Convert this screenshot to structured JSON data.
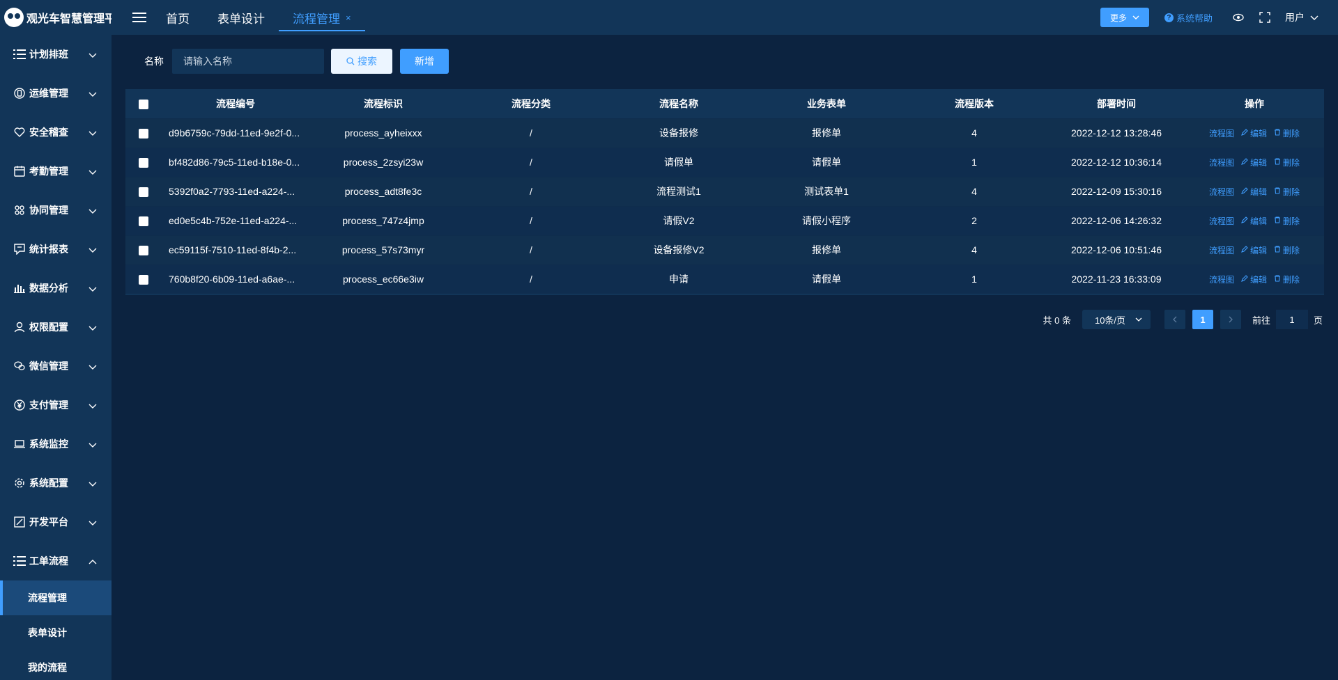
{
  "app": {
    "title": "观光车智慧管理平台"
  },
  "sidebar": {
    "items": [
      {
        "label": "计划排班",
        "icon": "list-icon"
      },
      {
        "label": "运维管理",
        "icon": "device-icon"
      },
      {
        "label": "安全稽查",
        "icon": "heart-icon"
      },
      {
        "label": "考勤管理",
        "icon": "calendar-icon"
      },
      {
        "label": "协同管理",
        "icon": "grid-icon"
      },
      {
        "label": "统计报表",
        "icon": "report-icon"
      },
      {
        "label": "数据分析",
        "icon": "bar-chart-icon"
      },
      {
        "label": "权限配置",
        "icon": "user-icon"
      },
      {
        "label": "微信管理",
        "icon": "wechat-icon"
      },
      {
        "label": "支付管理",
        "icon": "yuan-icon"
      },
      {
        "label": "系统监控",
        "icon": "monitor-icon"
      },
      {
        "label": "系统配置",
        "icon": "gear-icon"
      },
      {
        "label": "开发平台",
        "icon": "edit-icon"
      },
      {
        "label": "工单流程",
        "icon": "list-icon"
      }
    ],
    "submenu": [
      {
        "label": "流程管理",
        "active": true
      },
      {
        "label": "表单设计",
        "active": false
      },
      {
        "label": "我的流程",
        "active": false
      }
    ]
  },
  "header": {
    "tabs": [
      {
        "label": "首页",
        "active": false
      },
      {
        "label": "表单设计",
        "active": false
      },
      {
        "label": "流程管理",
        "active": true,
        "close": "×"
      }
    ],
    "more_label": "更多",
    "help_label": "系统帮助",
    "user_label": "用户"
  },
  "search": {
    "label": "名称",
    "placeholder": "请输入名称",
    "search_button": "搜索",
    "add_button": "新增"
  },
  "table": {
    "columns": [
      "流程编号",
      "流程标识",
      "流程分类",
      "流程名称",
      "业务表单",
      "流程版本",
      "部署时间",
      "操作"
    ],
    "rows": [
      {
        "id": "d9b6759c-79dd-11ed-9e2f-0...",
        "key": "process_ayheixxx",
        "category": "/",
        "name": "设备报修",
        "form": "报修单",
        "version": "4",
        "time": "2022-12-12 13:28:46"
      },
      {
        "id": "bf482d86-79c5-11ed-b18e-0...",
        "key": "process_2zsyi23w",
        "category": "/",
        "name": "请假单",
        "form": "请假单",
        "version": "1",
        "time": "2022-12-12 10:36:14"
      },
      {
        "id": "5392f0a2-7793-11ed-a224-...",
        "key": "process_adt8fe3c",
        "category": "/",
        "name": "流程测试1",
        "form": "测试表单1",
        "version": "4",
        "time": "2022-12-09 15:30:16"
      },
      {
        "id": "ed0e5c4b-752e-11ed-a224-...",
        "key": "process_747z4jmp",
        "category": "/",
        "name": "请假V2",
        "form": "请假小程序",
        "version": "2",
        "time": "2022-12-06 14:26:32"
      },
      {
        "id": "ec59115f-7510-11ed-8f4b-2...",
        "key": "process_57s73myr",
        "category": "/",
        "name": "设备报修V2",
        "form": "报修单",
        "version": "4",
        "time": "2022-12-06 10:51:46"
      },
      {
        "id": "760b8f20-6b09-11ed-a6ae-...",
        "key": "process_ec66e3iw",
        "category": "/",
        "name": "申请",
        "form": "请假单",
        "version": "1",
        "time": "2022-11-23 16:33:09"
      }
    ],
    "ops": {
      "diagram": "流程图",
      "edit": "编辑",
      "delete": "删除"
    }
  },
  "pager": {
    "total": "共 0 条",
    "page_size": "10条/页",
    "current": "1",
    "goto_prefix": "前往",
    "goto_value": "1",
    "goto_suffix": "页"
  },
  "colors": {
    "accent": "#409eff",
    "background": "#0c2340",
    "panel": "#123558"
  }
}
